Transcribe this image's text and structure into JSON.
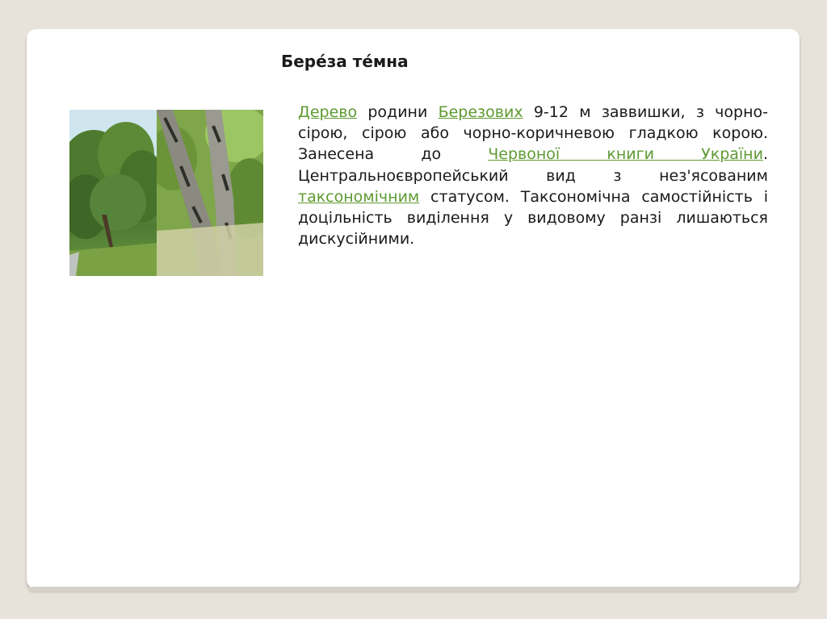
{
  "slide": {
    "title": "Бере́за те́мна",
    "image_alt": "berch-tree-photo",
    "paragraph": {
      "link_derevo": "Дерево",
      "text_1": " родини ",
      "link_berezovykh": "Березових",
      "text_2": " 9-12 м заввишки, з чорно-сірою, сірою або чорно-коричневою гладкою корою. Занесена до ",
      "link_chervona_knyha": "Червоної книги України",
      "text_3": ". Центральноєвропейський вид з нез'ясованим ",
      "link_taksonomichnym": "таксономічним",
      "text_4": " статусом. Таксономічна самостійність і доцільність виділення у видовому ранзі лишаються дискусійними."
    }
  },
  "colors": {
    "background": "#e8e3da",
    "slide": "#ffffff",
    "link": "#5e9a32",
    "text": "#1a1a1a"
  }
}
